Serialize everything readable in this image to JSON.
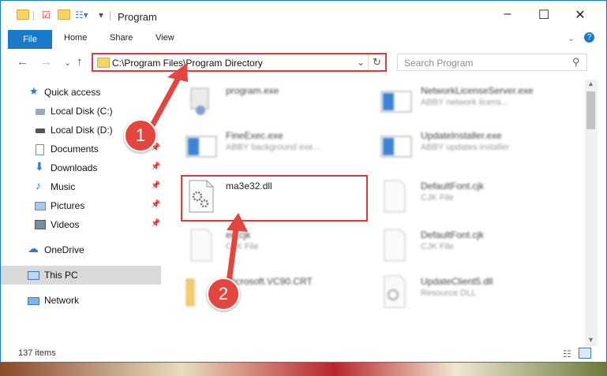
{
  "window": {
    "title": "Program"
  },
  "ribbon": {
    "file": "File",
    "tabs": [
      "Home",
      "Share",
      "View"
    ]
  },
  "address": {
    "path": "C:\\Program Files\\Program Directory"
  },
  "search": {
    "placeholder": "Search Program"
  },
  "sidebar": {
    "items": [
      {
        "label": "Quick access"
      },
      {
        "label": "Local Disk (C:)"
      },
      {
        "label": "Local Disk (D:)"
      },
      {
        "label": "Documents"
      },
      {
        "label": "Downloads"
      },
      {
        "label": "Music"
      },
      {
        "label": "Pictures"
      },
      {
        "label": "Videos"
      },
      {
        "label": "OneDrive"
      },
      {
        "label": "This PC"
      },
      {
        "label": "Network"
      }
    ]
  },
  "files": [
    {
      "name": "program.exe",
      "desc": ""
    },
    {
      "name": "NetworkLicenseServer.exe",
      "desc": "ABBY network licens..."
    },
    {
      "name": "FineExec.exe",
      "desc": "ABBY background exe..."
    },
    {
      "name": "UpdateInstaller.exe",
      "desc": "ABBY updates installer"
    },
    {
      "name": "ma3e32.dll",
      "desc": ""
    },
    {
      "name": "DefaultFont.cjk",
      "desc": "CJK File"
    },
    {
      "name": "ed.cjk",
      "desc": "CJK File"
    },
    {
      "name": "DefaultFont.cjk",
      "desc": "CJK File"
    },
    {
      "name": "Microsoft.VC90.CRT",
      "desc": ""
    },
    {
      "name": "UpdateClient5.dll",
      "desc": "Resource DLL"
    }
  ],
  "status": {
    "count": "137 items"
  },
  "steps": [
    "1",
    "2"
  ],
  "colors": {
    "accent": "#1979ca",
    "highlight": "#e0393c"
  }
}
